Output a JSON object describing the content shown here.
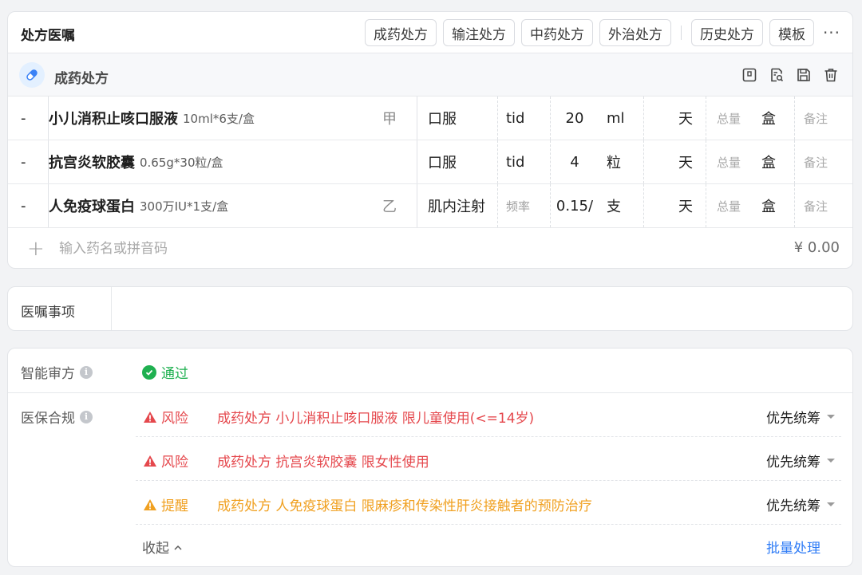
{
  "prescription": {
    "title": "处方医嘱",
    "tabs": [
      "成药处方",
      "输注处方",
      "中药处方",
      "外治处方"
    ],
    "history_tab": "历史处方",
    "template_tab": "模板",
    "more_label": "···",
    "section_title": "成药处方",
    "drugs": [
      {
        "name": "小儿消积止咳口服液",
        "spec": "10ml*6支/盒",
        "level": "甲",
        "route": "口服",
        "frequency": "tid",
        "dose": "20",
        "dose_unit": "ml",
        "day_unit": "天",
        "total_placeholder": "总量",
        "total_unit": "盒",
        "note_placeholder": "备注",
        "minus": "-"
      },
      {
        "name": "抗宫炎软胶囊",
        "spec": "0.65g*30粒/盒",
        "level": "",
        "route": "口服",
        "frequency": "tid",
        "dose": "4",
        "dose_unit": "粒",
        "day_unit": "天",
        "total_placeholder": "总量",
        "total_unit": "盒",
        "note_placeholder": "备注",
        "minus": "-"
      },
      {
        "name": "人免疫球蛋白",
        "spec": "300万IU*1支/盒",
        "level": "乙",
        "route": "肌内注射",
        "frequency_placeholder": "频率",
        "dose": "0.15/",
        "dose_unit": "支",
        "day_unit": "天",
        "total_placeholder": "总量",
        "total_unit": "盒",
        "note_placeholder": "备注",
        "minus": "-"
      }
    ],
    "add_placeholder": "输入药名或拼音码",
    "total_price": "¥ 0.00"
  },
  "orders": {
    "label": "医嘱事项",
    "value": ""
  },
  "review": {
    "smart_label": "智能审方",
    "smart_status": "通过",
    "insurance_label": "医保合规",
    "issues": [
      {
        "level": "风险",
        "message": "成药处方 小儿消积止咳口服液 限儿童使用(<=14岁)",
        "option": "优先统筹",
        "color": "#e5484d"
      },
      {
        "level": "风险",
        "message": "成药处方 抗宫炎软胶囊 限女性使用",
        "option": "优先统筹",
        "color": "#e5484d"
      },
      {
        "level": "提醒",
        "message": "成药处方 人免疫球蛋白 限麻疹和传染性肝炎接触者的预防治疗",
        "option": "优先统筹",
        "color": "#f0a020"
      }
    ],
    "collapse_label": "收起",
    "batch_label": "批量处理"
  },
  "colors": {
    "accent": "#2f7cf6",
    "pass": "#1fb050",
    "risk": "#e5484d",
    "warn": "#f0a020"
  },
  "icons": [
    "pill-icon",
    "template-icon",
    "search-document-icon",
    "save-icon",
    "trash-icon",
    "info-icon",
    "check-circle-icon",
    "warning-triangle-icon",
    "plus-icon",
    "chevron-up-icon",
    "caret-down-icon"
  ]
}
